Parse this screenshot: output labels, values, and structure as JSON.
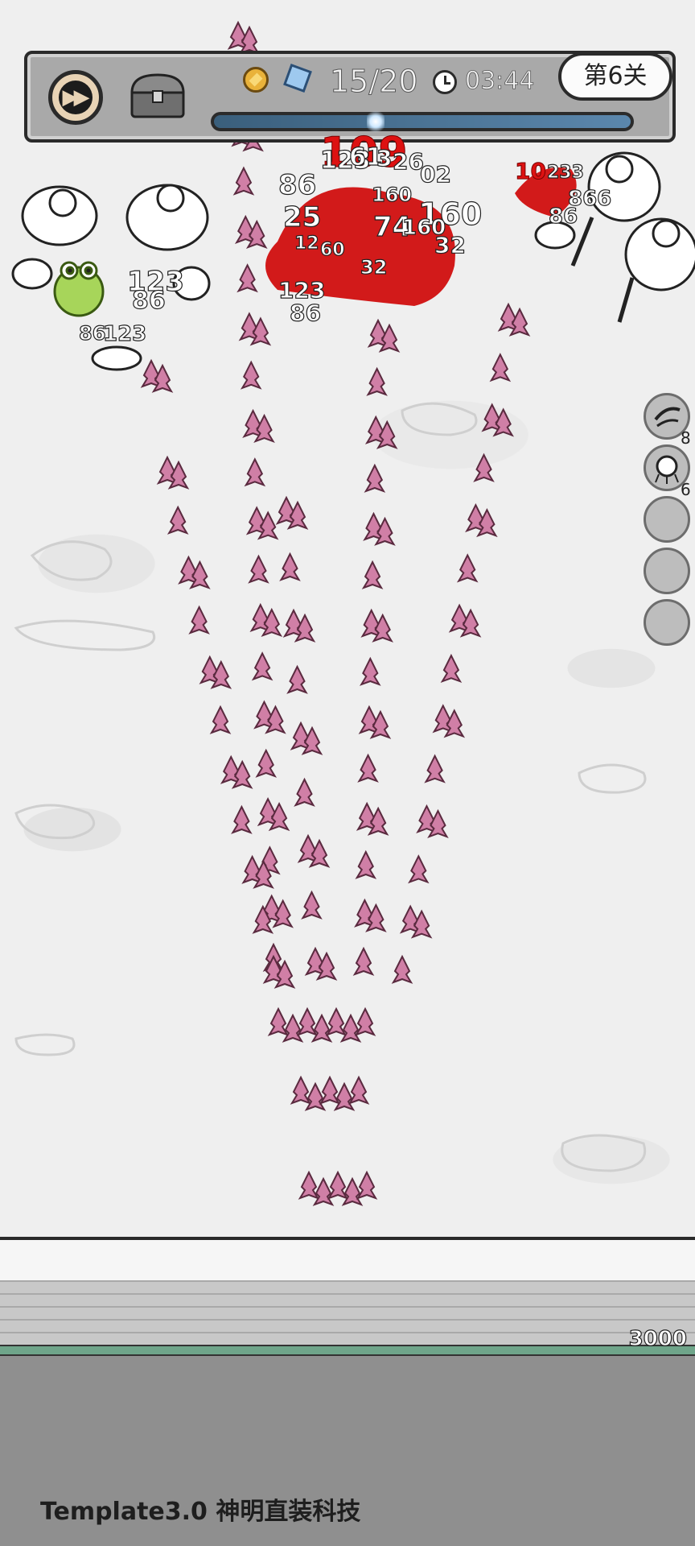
{
  "hud": {
    "speed_button_icon": "fast-forward-icon",
    "chest_icon": "treasure-chest-icon",
    "coin_icon": "gold-coin-icon",
    "gem_icon": "blue-gem-icon",
    "wave_progress": "15/20",
    "clock_icon": "clock-icon",
    "timer": "03:44",
    "level_label": "第6关",
    "level_progress": 0.2
  },
  "damage_numbers": [
    {
      "text": "109",
      "red": true
    },
    {
      "text": "123",
      "red": false
    },
    {
      "text": "61",
      "red": false
    },
    {
      "text": "3",
      "red": false
    },
    {
      "text": "26",
      "red": false
    },
    {
      "text": "02",
      "red": false
    },
    {
      "text": "86",
      "red": false
    },
    {
      "text": "160",
      "red": false
    },
    {
      "text": "160",
      "red": false
    },
    {
      "text": "25",
      "red": false
    },
    {
      "text": "74",
      "red": false
    },
    {
      "text": "160",
      "red": false
    },
    {
      "text": "32",
      "red": false
    },
    {
      "text": "60",
      "red": false
    },
    {
      "text": "32",
      "red": false
    },
    {
      "text": "12",
      "red": false
    },
    {
      "text": "123",
      "red": false
    },
    {
      "text": "86",
      "red": false
    },
    {
      "text": "123",
      "red": false
    },
    {
      "text": "86",
      "red": false
    },
    {
      "text": "86",
      "red": false
    },
    {
      "text": "123",
      "red": false
    },
    {
      "text": "10",
      "red": true
    },
    {
      "text": "233",
      "red": false
    },
    {
      "text": "86",
      "red": false
    },
    {
      "text": "866",
      "red": false
    }
  ],
  "skill_slots": [
    {
      "icon": "wind-blade-skill-icon",
      "count": "8"
    },
    {
      "icon": "spirit-skill-icon",
      "count": "6"
    },
    {
      "icon": "empty-slot",
      "count": ""
    },
    {
      "icon": "empty-slot",
      "count": ""
    },
    {
      "icon": "empty-slot",
      "count": ""
    }
  ],
  "wall_hp": "3000",
  "hero": "staff-mage",
  "watermark": "Template3.0 神明直装科技",
  "colors": {
    "projectile": "#d07fa6",
    "blood": "#d21a1a",
    "hud_bg": "#a9a9a9",
    "progress_fill": "#5b87ad"
  }
}
